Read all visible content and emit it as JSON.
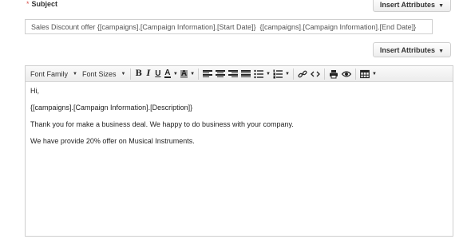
{
  "subject": {
    "required_marker": "*",
    "label": "Subject",
    "value": "Sales Discount offer {[campaigns].[Campaign Information].[Start Date]}  {[campaigns].[Campaign Information].[End Date]}"
  },
  "insert_attributes": {
    "subject_button_label": "Insert Attributes",
    "body_button_label": "Insert Attributes"
  },
  "toolbar": {
    "font_family_label": "Font Family",
    "font_sizes_label": "Font Sizes",
    "bold": "B",
    "italic": "I",
    "underline": "U",
    "font_color": "A",
    "background_color": "A",
    "icons": [
      "align-left-icon",
      "align-center-icon",
      "align-right-icon",
      "align-justify-icon",
      "bullet-list-icon",
      "numbered-list-icon",
      "link-icon",
      "code-icon",
      "print-icon",
      "preview-icon",
      "table-icon"
    ]
  },
  "body": {
    "lines": [
      "Hi,",
      "{[campaigns].[Campaign Information].[Description]}",
      "Thank you for make a business deal. We happy to do business with your company.",
      "We have provide 20% offer on Musical Instruments."
    ]
  }
}
